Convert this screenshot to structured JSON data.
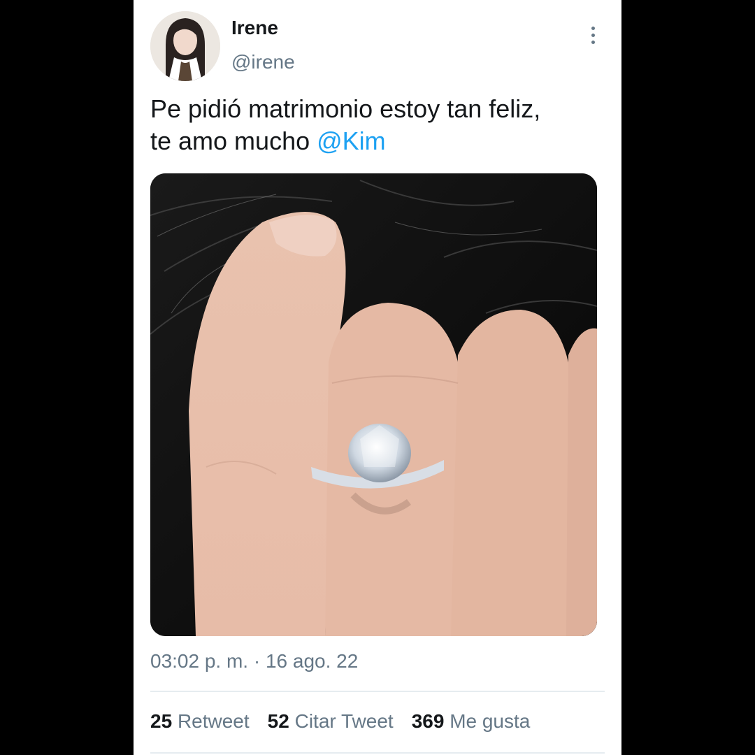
{
  "author": {
    "name": "Irene",
    "handle": "@irene"
  },
  "tweet": {
    "line1": "Pe pidió matrimonio estoy tan feliz,",
    "line2_prefix": "te amo mucho ",
    "mention": "@Kim",
    "timestamp": "03:02 p. m. · 16 ago. 22"
  },
  "stats": {
    "retweets": {
      "count": "25",
      "label": "Retweet"
    },
    "quotes": {
      "count": "52",
      "label": "Citar Tweet"
    },
    "likes": {
      "count": "369",
      "label": "Me gusta"
    }
  },
  "colors": {
    "mention": "#1da1f2",
    "secondary_text": "#657786",
    "primary_text": "#14171a"
  },
  "icons": {
    "more": "more-vertical-icon"
  }
}
